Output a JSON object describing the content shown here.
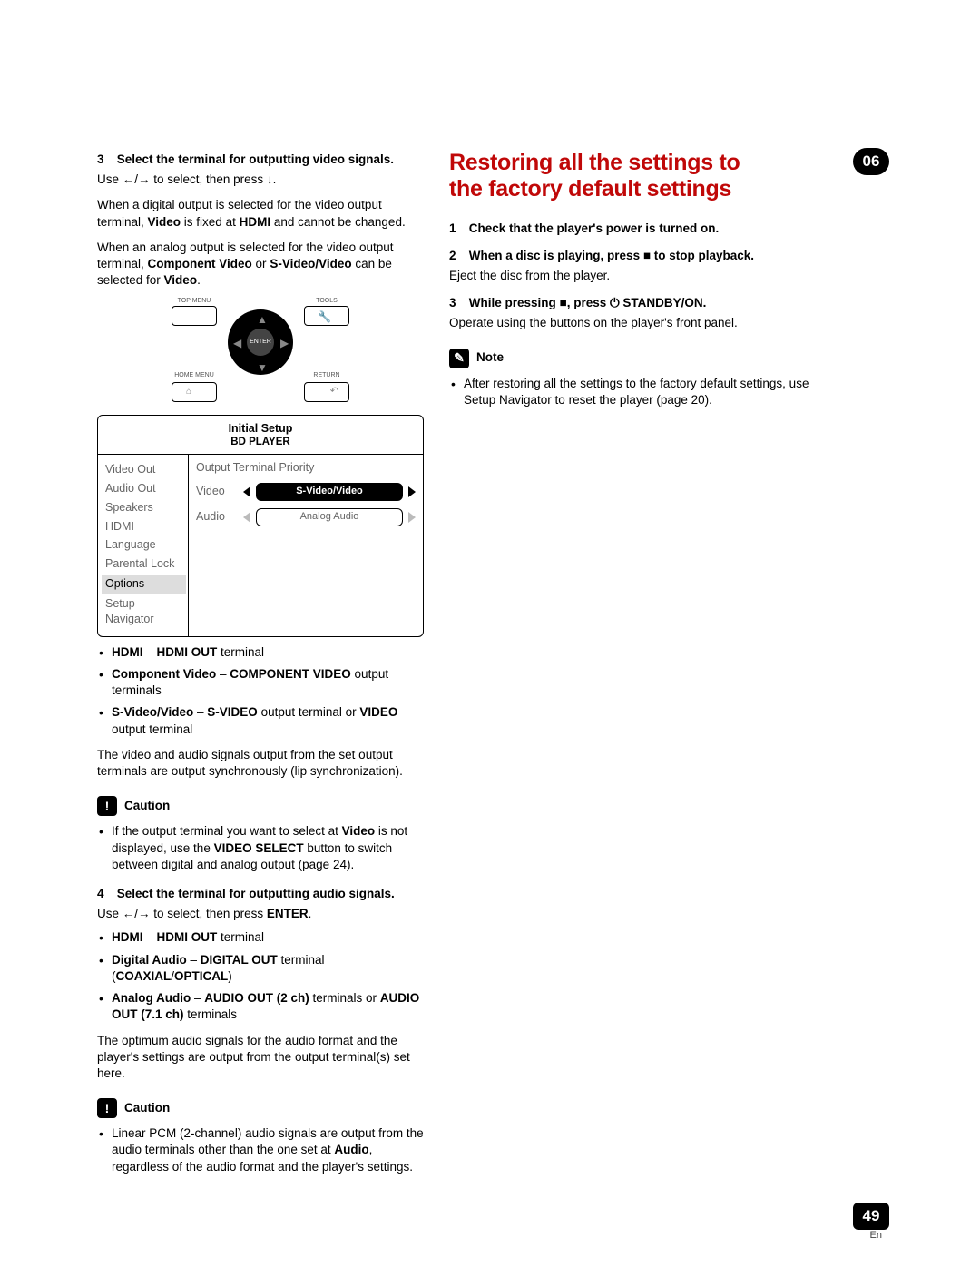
{
  "chapter_badge": "06",
  "page_number": "49",
  "page_lang": "En",
  "left": {
    "step3_title": "Select the terminal for outputting video signals.",
    "step3_num": "3",
    "use_prefix": "Use ",
    "use_suffix": " to select, then press ",
    "use_end": ".",
    "digital_line_a": "When a digital output is selected for the video output terminal, ",
    "digital_line_b": " is fixed at ",
    "digital_line_c": " and cannot be changed.",
    "video_word": "Video",
    "hdmi_word": "HDMI",
    "analog_line_a": "When an analog output is selected for the video output terminal, ",
    "analog_line_b": " or ",
    "analog_line_c": " can be selected for ",
    "component_video": "Component Video",
    "svideo_video": "S-Video/Video",
    "remote": {
      "top_menu": "TOP MENU",
      "tools": "TOOLS",
      "home_menu": "HOME MENU",
      "return": "RETURN",
      "enter": "ENTER"
    },
    "osd": {
      "title1": "Initial Setup",
      "title2": "BD PLAYER",
      "menu": [
        "Video Out",
        "Audio Out",
        "Speakers",
        "HDMI",
        "Language",
        "Parental Lock",
        "Options",
        "Setup Navigator"
      ],
      "right_title": "Output Terminal Priority",
      "row_video": "Video",
      "row_video_val": "S-Video/Video",
      "row_audio": "Audio",
      "row_audio_val": "Analog Audio"
    },
    "bullets_video": {
      "b1a": "HDMI",
      "b1b": " – ",
      "b1c": "HDMI OUT",
      "b1d": " terminal",
      "b2a": "Component Video",
      "b2b": " – ",
      "b2c": "COMPONENT VIDEO",
      "b2d": " output terminals",
      "b3a": "S-Video/Video",
      "b3b": " – ",
      "b3c": "S-VIDEO",
      "b3d": " output terminal or ",
      "b3e": "VIDEO",
      "b3f": " output terminal"
    },
    "sync_line": "The video and audio signals output from the set output terminals are output synchronously (lip synchronization).",
    "caution_label": "Caution",
    "caution1_a": "If the output terminal you want to select at ",
    "caution1_b": " is not displayed, use the ",
    "caution1_c": " button to switch between digital and analog output (page 24).",
    "video_select": "VIDEO SELECT",
    "step4_num": "4",
    "step4_title": "Select the terminal for outputting audio signals.",
    "use2_suffix": " to select, then press ",
    "enter_word": "ENTER",
    "bullets_audio": {
      "b1a": "HDMI",
      "b1b": " – ",
      "b1c": "HDMI OUT",
      "b1d": " terminal",
      "b2a": "Digital Audio",
      "b2b": " – ",
      "b2c": "DIGITAL OUT",
      "b2d": " terminal (",
      "b2e": "COAXIAL",
      "b2f": "/",
      "b2g": "OPTICAL",
      "b2h": ")",
      "b3a": "Analog Audio",
      "b3b": " – ",
      "b3c": "AUDIO OUT (2 ch)",
      "b3d": " terminals or ",
      "b3e": "AUDIO OUT (7.1 ch)",
      "b3f": " terminals"
    },
    "opt_line": "The optimum audio signals for the audio format and the player's settings are output from the output terminal(s) set here.",
    "caution2_a": "Linear PCM (2-channel) audio signals are output from the audio terminals other than the one set at ",
    "caution2_b": ", regardless of the audio format and the player's settings.",
    "audio_word": "Audio"
  },
  "right": {
    "heading": "Restoring all the settings to the factory default settings",
    "s1_num": "1",
    "s1": "Check that the player's power is turned on.",
    "s2_num": "2",
    "s2a": "When a disc is playing, press ",
    "s2b": " to stop playback.",
    "s2_line": "Eject the disc from the player.",
    "s3_num": "3",
    "s3a": "While pressing ",
    "s3b": ", press ",
    "s3c": " STANDBY/ON.",
    "s3_line": "Operate using the buttons on the player's front panel.",
    "note_label": "Note",
    "note_a": "After restoring all the settings to the factory default settings, use Setup Navigator to reset the player (page 20)."
  }
}
